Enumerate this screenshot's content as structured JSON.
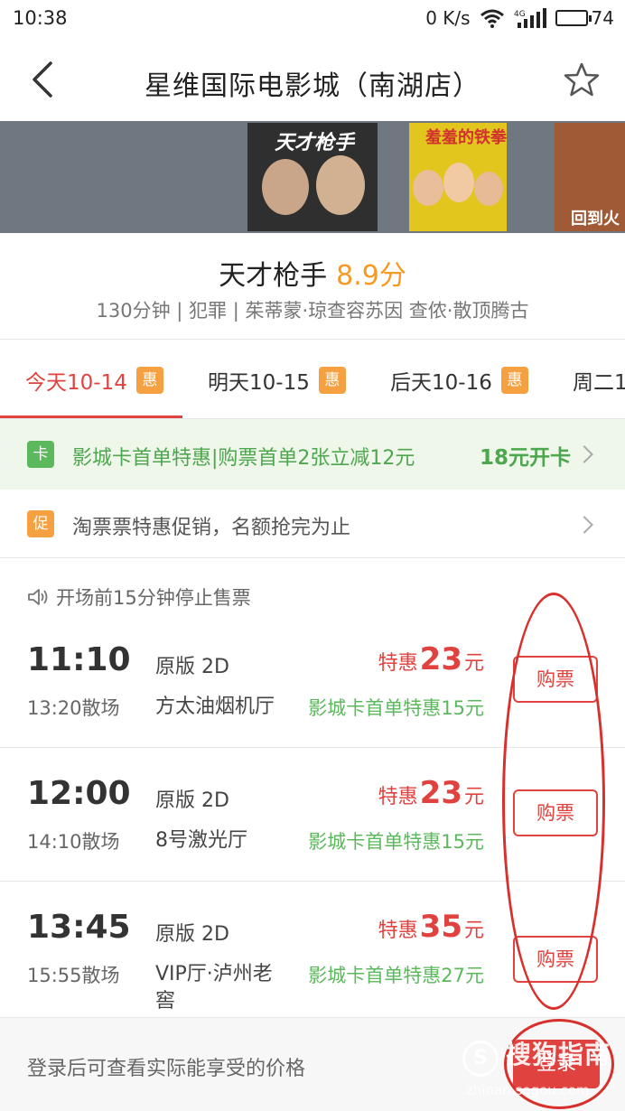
{
  "status_bar": {
    "time": "10:38",
    "net_speed": "0 K/s",
    "network": "4G",
    "battery": "74",
    "battery_level_percent": 74
  },
  "header": {
    "title": "星维国际电影城（南湖店）",
    "back_icon": "chevron-left-icon",
    "favorite_icon": "star-outline-icon"
  },
  "posters": [
    {
      "title": "天才枪手"
    },
    {
      "title": "羞羞的铁拳"
    },
    {
      "title": "回到火"
    }
  ],
  "movie": {
    "title": "天才枪手",
    "score": "8.9分",
    "meta": "130分钟 | 犯罪 | 茱蒂蒙·琼查容苏因 查侬·散顶腾古"
  },
  "date_tabs": [
    {
      "label": "今天10-14",
      "badge": "惠"
    },
    {
      "label": "明天10-15",
      "badge": "惠"
    },
    {
      "label": "后天10-16",
      "badge": "惠"
    },
    {
      "label": "周二1",
      "badge": ""
    }
  ],
  "card_promo": {
    "tag": "卡",
    "text": "影城卡首单特惠|购票首单2张立减12元",
    "action": "18元开卡"
  },
  "sale_promo": {
    "tag": "促",
    "text": "淘票票特惠促销，名额抢完为止"
  },
  "notice": "开场前15分钟停止售票",
  "showtimes": [
    {
      "start": "11:10",
      "end": "13:20散场",
      "version": "原版 2D",
      "hall": "方太油烟机厅",
      "price_prefix": "特惠",
      "price": "23",
      "price_unit": "元",
      "card_price": "影城卡首单特惠15元",
      "buy_label": "购票"
    },
    {
      "start": "12:00",
      "end": "14:10散场",
      "version": "原版 2D",
      "hall": "8号激光厅",
      "price_prefix": "特惠",
      "price": "23",
      "price_unit": "元",
      "card_price": "影城卡首单特惠15元",
      "buy_label": "购票"
    },
    {
      "start": "13:45",
      "end": "15:55散场",
      "version": "原版 2D",
      "hall": "VIP厅·泸州老窖",
      "price_prefix": "特惠",
      "price": "35",
      "price_unit": "元",
      "card_price": "影城卡首单特惠27元",
      "buy_label": "购票"
    }
  ],
  "login_bar": {
    "text": "登录后可查看实际能享受的价格",
    "button": "登录"
  },
  "watermark": {
    "logo": "S",
    "name": "搜狗指南",
    "url": "zhinan.sogou.com"
  },
  "colors": {
    "accent_red": "#e0433f",
    "score_orange": "#f59a23",
    "promo_green": "#5cb85c",
    "badge_orange": "#f5a142",
    "annotation_red": "#d8302c"
  }
}
